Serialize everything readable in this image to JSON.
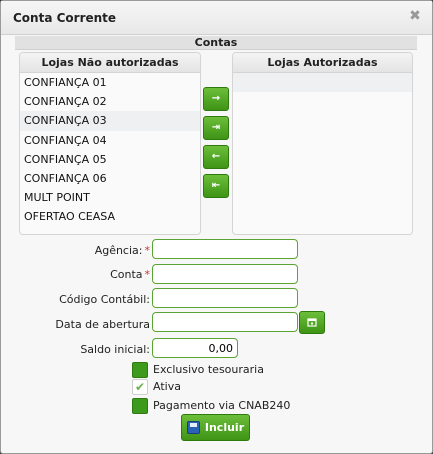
{
  "window": {
    "title": "Conta Corrente",
    "close_glyph": "✖"
  },
  "section": {
    "title": "Contas"
  },
  "lists": {
    "unauthorized": {
      "title": "Lojas Não autorizadas",
      "items": [
        "CONFIANÇA 01",
        "CONFIANÇA 02",
        "CONFIANÇA 03",
        "CONFIANÇA 04",
        "CONFIANÇA 05",
        "CONFIANÇA 06",
        "MULT POINT",
        "OFERTAO CEASA"
      ]
    },
    "authorized": {
      "title": "Lojas Autorizadas",
      "items": []
    }
  },
  "transfer_buttons": [
    {
      "name": "move-one-right",
      "glyph": "→"
    },
    {
      "name": "move-all-right",
      "glyph": "⇥"
    },
    {
      "name": "move-one-left",
      "glyph": "←"
    },
    {
      "name": "move-all-left",
      "glyph": "⇤"
    }
  ],
  "form": {
    "agencia": {
      "label": "Agência:",
      "required": "*",
      "value": ""
    },
    "conta": {
      "label": "Conta",
      "required": "*",
      "value": ""
    },
    "codigo_contabil": {
      "label": "Código Contábil:",
      "value": ""
    },
    "data_abertura": {
      "label": "Data de abertura",
      "value": ""
    },
    "saldo_inicial": {
      "label": "Saldo inicial:",
      "value": "0,00"
    }
  },
  "checkboxes": [
    {
      "label": "Exclusivo tesouraria",
      "checked": false
    },
    {
      "label": "Ativa",
      "checked": true
    },
    {
      "label": "Pagamento via CNAB240",
      "checked": false
    }
  ],
  "actions": {
    "submit_label": "Incluir"
  },
  "icons": {
    "close": "close-icon",
    "calendar": "calendar-icon",
    "save": "floppy-disk-icon",
    "check": "check-icon"
  },
  "colors": {
    "accent_green": "#3f9416",
    "input_border": "#5aa531",
    "required_star": "#d23232",
    "check_mark": "#6ab04a"
  }
}
